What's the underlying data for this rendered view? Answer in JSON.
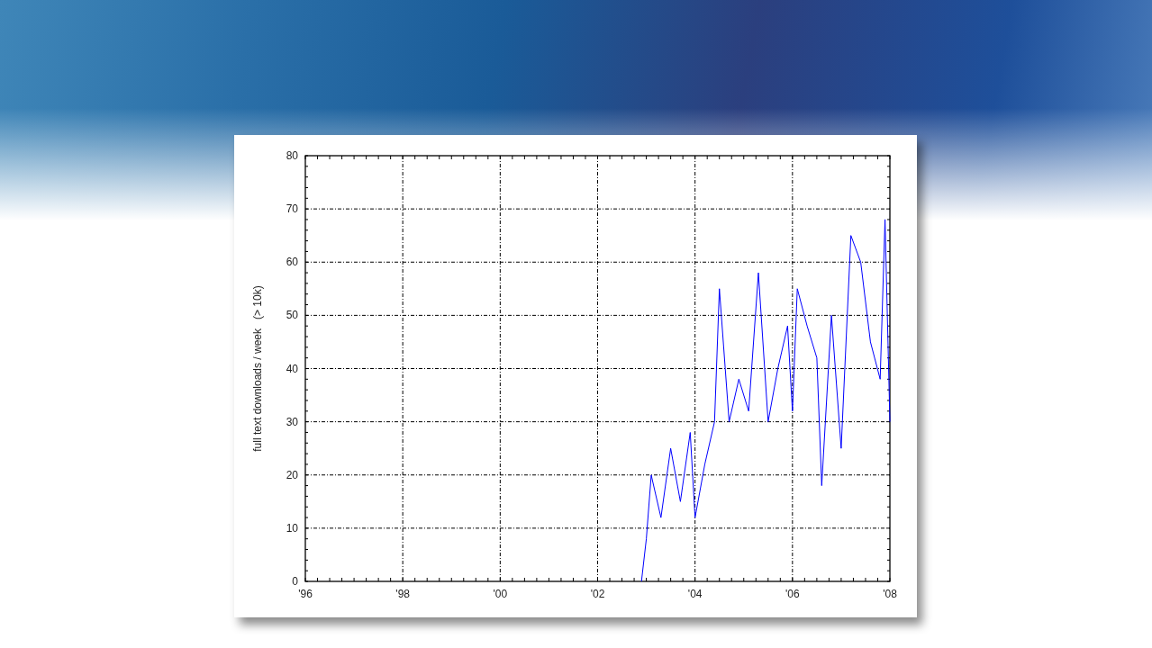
{
  "chart": {
    "chart_data": {
      "type": "line",
      "ylabel": "full text downloads / week   (> 10k)",
      "x": [
        2002.9,
        2003.0,
        2003.1,
        2003.3,
        2003.5,
        2003.7,
        2003.9,
        2004.0,
        2004.2,
        2004.4,
        2004.5,
        2004.7,
        2004.9,
        2005.1,
        2005.3,
        2005.5,
        2005.7,
        2005.9,
        2006.0,
        2006.1,
        2006.3,
        2006.5,
        2006.6,
        2006.8,
        2007.0,
        2007.2,
        2007.4,
        2007.6,
        2007.8,
        2007.9,
        2008.0
      ],
      "grid": true,
      "series": [
        {
          "color": "#0000ff",
          "values": [
            0,
            8,
            20,
            12,
            25,
            15,
            28,
            12,
            22,
            30,
            55,
            30,
            38,
            32,
            58,
            30,
            40,
            48,
            32,
            55,
            48,
            42,
            18,
            50,
            25,
            65,
            60,
            45,
            38,
            68,
            30
          ]
        }
      ],
      "xlim": [
        1996,
        2008
      ],
      "ylim": [
        0,
        80
      ],
      "xticks": [
        {
          "value": 1996,
          "label": "'96"
        },
        {
          "value": 1998,
          "label": "'98"
        },
        {
          "value": 2000,
          "label": "'00"
        },
        {
          "value": 2002,
          "label": "'02"
        },
        {
          "value": 2004,
          "label": "'04"
        },
        {
          "value": 2006,
          "label": "'06"
        },
        {
          "value": 2008,
          "label": "'08"
        }
      ],
      "yticks": [
        0,
        10,
        20,
        30,
        40,
        50,
        60,
        70,
        80
      ]
    }
  }
}
